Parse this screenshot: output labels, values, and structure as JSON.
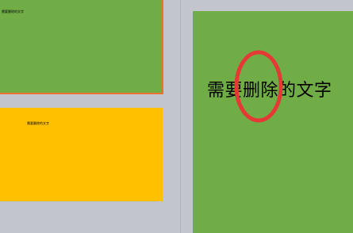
{
  "thumbnails": [
    {
      "text": "需要删除的文字",
      "selected": true,
      "background": "#70ad47"
    },
    {
      "text": "需要删除的文字",
      "selected": false,
      "background": "#ffc000"
    }
  ],
  "slide": {
    "text": "需要删除的文字",
    "background": "#70ad47"
  },
  "annotation": {
    "shape": "red-ellipse",
    "color": "#e53935"
  }
}
